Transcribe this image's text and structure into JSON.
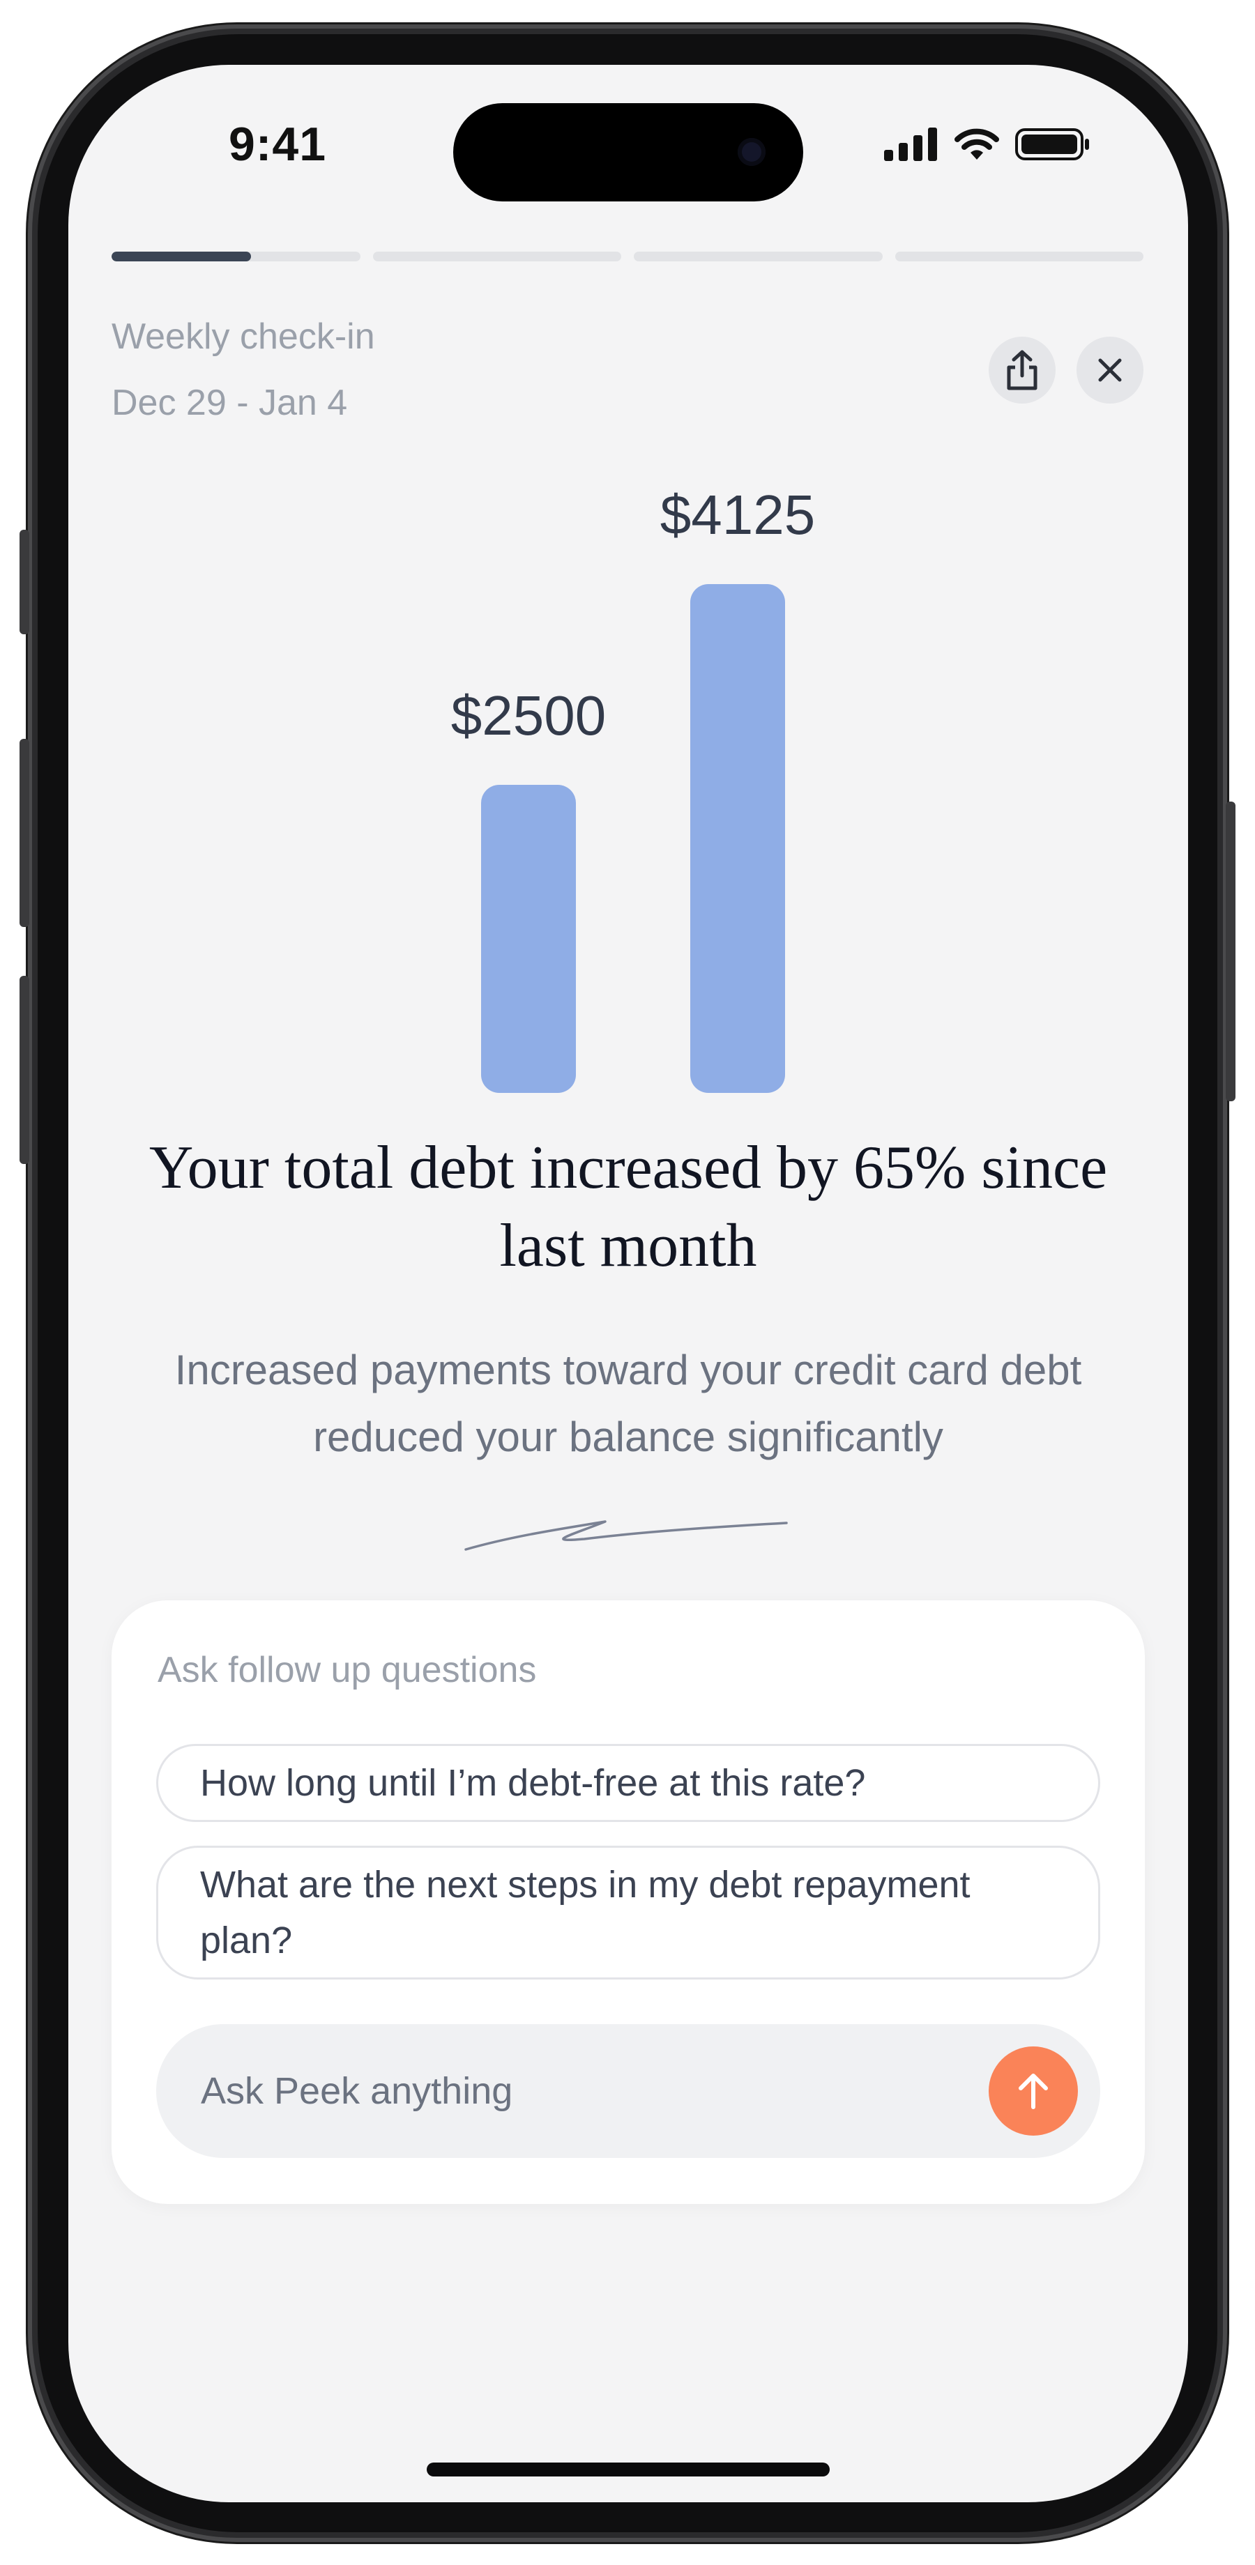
{
  "status_bar": {
    "time": "9:41"
  },
  "progress": {
    "segments": [
      0.56,
      0,
      0,
      0
    ]
  },
  "header": {
    "title": "Weekly check-in",
    "date_range": "Dec 29 - Jan 4",
    "share_icon": "share-icon",
    "close_icon": "close-icon"
  },
  "chart_data": {
    "type": "bar",
    "categories": [
      "",
      ""
    ],
    "values": [
      2500,
      4125
    ],
    "value_labels": [
      "$2500",
      "$4125"
    ],
    "color": "#8fade6",
    "ylim": [
      0,
      4125
    ]
  },
  "headline": "Your total debt increased by 65% since last month",
  "subtext": "Increased payments toward your credit card debt reduced your balance significantly",
  "followup": {
    "title": "Ask follow up questions",
    "questions": [
      "How long until I’m debt-free at this rate?",
      "What are the next steps in my debt repayment plan?"
    ],
    "ask_placeholder": "Ask Peek anything",
    "send_icon": "arrow-up-icon"
  },
  "colors": {
    "accent": "#fa8358",
    "bar": "#8fade6",
    "progress_active": "#3b4555"
  }
}
